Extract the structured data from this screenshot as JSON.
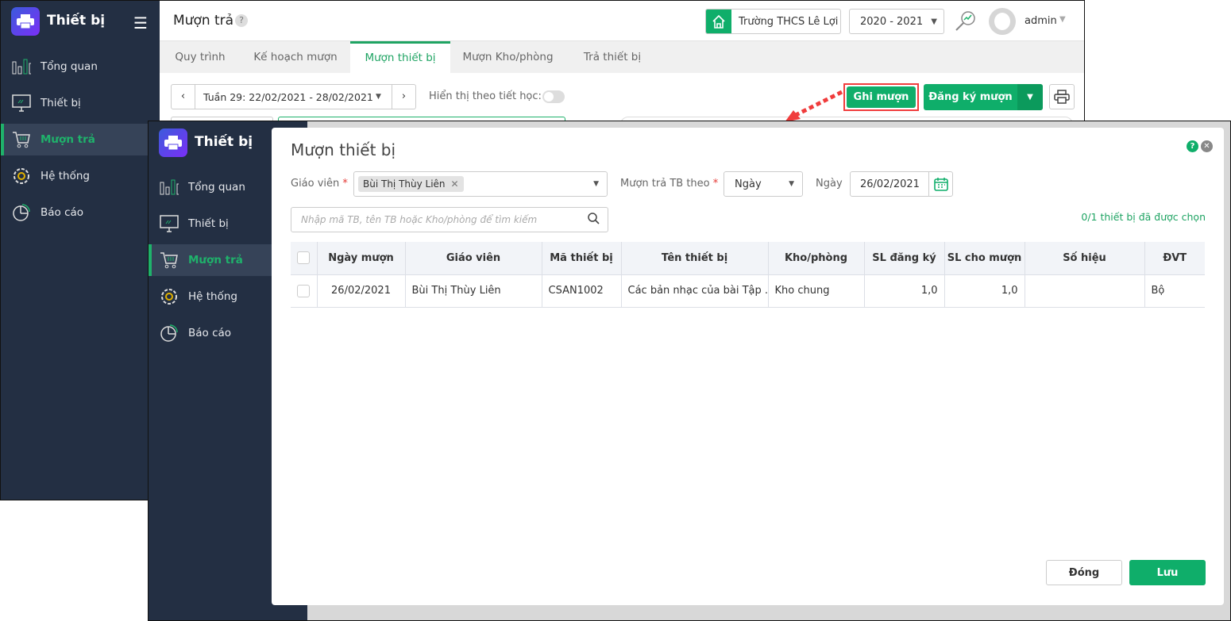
{
  "app": {
    "brand": "Thiết bị"
  },
  "sidebar": {
    "items": [
      {
        "label": "Tổng quan",
        "icon": "bar-chart-icon"
      },
      {
        "label": "Thiết bị",
        "icon": "monitor-icon"
      },
      {
        "label": "Mượn trả",
        "icon": "cart-icon",
        "active": true
      },
      {
        "label": "Hệ thống",
        "icon": "gear-icon"
      },
      {
        "label": "Báo cáo",
        "icon": "pie-chart-icon"
      }
    ]
  },
  "header": {
    "title": "Mượn trả",
    "help": "?",
    "school": "Trường THCS Lê Lợi",
    "year": "2020 - 2021",
    "user": "admin"
  },
  "tabs": [
    "Quy trình",
    "Kế hoạch mượn",
    "Mượn thiết bị",
    "Mượn Kho/phòng",
    "Trả thiết bị"
  ],
  "toolbar": {
    "week": "Tuần 29: 22/02/2021 - 28/02/2021",
    "show_by_period": "Hiển thị theo tiết học:",
    "show_by_period_on": false,
    "record_btn": "Ghi mượn",
    "register_btn": "Đăng ký mượn"
  },
  "colors": {
    "accent": "#0fae6a",
    "sidebar": "#232f43",
    "highlight": "#f03c3c"
  },
  "modal": {
    "title": "Mượn thiết bị",
    "teacher_label": "Giáo viên",
    "teacher_tag": "Bùi Thị Thùy Liên",
    "by_label": "Mượn trả TB theo",
    "by_value": "Ngày",
    "date_label": "Ngày",
    "date_value": "26/02/2021",
    "search_placeholder": "Nhập mã TB, tên TB hoặc Kho/phòng để tìm kiếm",
    "selected_count": "0/1 thiết bị đã được chọn",
    "columns": [
      "Ngày mượn",
      "Giáo viên",
      "Mã thiết bị",
      "Tên thiết bị",
      "Kho/phòng",
      "SL đăng ký",
      "SL cho mượn",
      "Số hiệu",
      "ĐVT"
    ],
    "rows": [
      {
        "date": "26/02/2021",
        "teacher": "Bùi Thị Thùy Liên",
        "code": "CSAN1002",
        "name": "Các bản nhạc của bài Tập ...",
        "room": "Kho chung",
        "reg": "1,0",
        "lend": "1,0",
        "serial": "",
        "unit": "Bộ"
      }
    ],
    "close_btn": "Đóng",
    "save_btn": "Lưu"
  }
}
